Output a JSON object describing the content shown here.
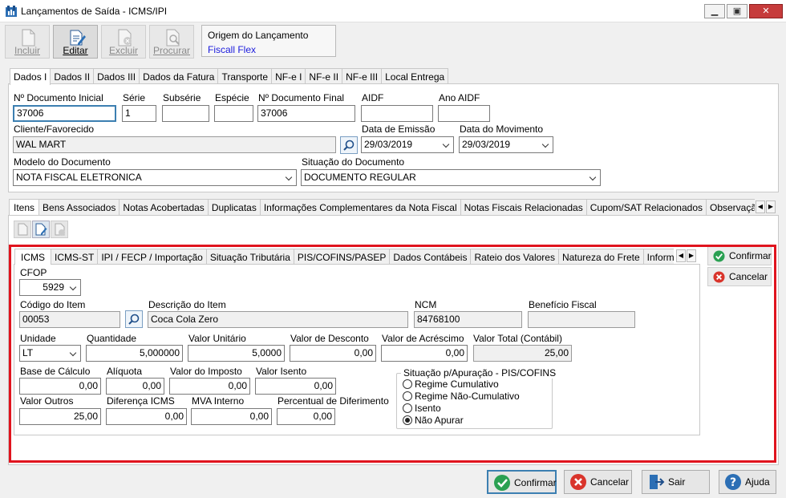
{
  "window": {
    "title": "Lançamentos de Saída - ICMS/IPI"
  },
  "toolbar": {
    "incluir": "Incluir",
    "editar": "Editar",
    "excluir": "Excluir",
    "procurar": "Procurar"
  },
  "origin": {
    "label": "Origem do Lançamento",
    "value": "Fiscall Flex"
  },
  "main_tabs": [
    "Dados I",
    "Dados II",
    "Dados III",
    "Dados da Fatura",
    "Transporte",
    "NF-e I",
    "NF-e II",
    "NF-e III",
    "Local Entrega"
  ],
  "header": {
    "doc_inicial": {
      "label": "Nº Documento Inicial",
      "value": "37006"
    },
    "serie": {
      "label": "Série",
      "value": "1"
    },
    "subserie": {
      "label": "Subsérie",
      "value": ""
    },
    "especie": {
      "label": "Espécie",
      "value": ""
    },
    "doc_final": {
      "label": "Nº Documento Final",
      "value": "37006"
    },
    "aidf": {
      "label": "AIDF",
      "value": ""
    },
    "ano_aidf": {
      "label": "Ano AIDF",
      "value": ""
    },
    "cliente": {
      "label": "Cliente/Favorecido",
      "value": "WAL MART"
    },
    "data_emissao": {
      "label": "Data de Emissão",
      "value": "29/03/2019"
    },
    "data_movimento": {
      "label": "Data do Movimento",
      "value": "29/03/2019"
    },
    "modelo": {
      "label": "Modelo do Documento",
      "value": "NOTA FISCAL ELETRONICA"
    },
    "situacao": {
      "label": "Situação do Documento",
      "value": "DOCUMENTO REGULAR"
    }
  },
  "item_tabs": [
    "Itens",
    "Bens Associados",
    "Notas Acobertadas",
    "Duplicatas",
    "Informações Complementares da Nota Fiscal",
    "Notas Fiscais Relacionadas",
    "Cupom/SAT Relacionados",
    "Observação d"
  ],
  "tax_tabs": [
    "ICMS",
    "ICMS-ST",
    "IPI / FECP / Importação",
    "Situação Tributária",
    "PIS/COFINS/PASEP",
    "Dados Contábeis",
    "Rateio dos Valores",
    "Natureza do Frete",
    "Informações"
  ],
  "icms": {
    "cfop": {
      "label": "CFOP",
      "value": "5929"
    },
    "codigo_item": {
      "label": "Código do Item",
      "value": "00053"
    },
    "descricao_item": {
      "label": "Descrição do Item",
      "value": "Coca Cola Zero"
    },
    "ncm": {
      "label": "NCM",
      "value": "84768100"
    },
    "beneficio": {
      "label": "Benefício Fiscal",
      "value": ""
    },
    "unidade": {
      "label": "Unidade",
      "value": "LT"
    },
    "quantidade": {
      "label": "Quantidade",
      "value": "5,000000"
    },
    "valor_unitario": {
      "label": "Valor Unitário",
      "value": "5,0000"
    },
    "valor_desconto": {
      "label": "Valor de Desconto",
      "value": "0,00"
    },
    "valor_acrescimo": {
      "label": "Valor de Acréscimo",
      "value": "0,00"
    },
    "valor_total": {
      "label": "Valor Total (Contábil)",
      "value": "25,00"
    },
    "base_calculo": {
      "label": "Base de Cálculo",
      "value": "0,00"
    },
    "aliquota": {
      "label": "Alíquota",
      "value": "0,00"
    },
    "valor_imposto": {
      "label": "Valor do Imposto",
      "value": "0,00"
    },
    "valor_isento": {
      "label": "Valor Isento",
      "value": "0,00"
    },
    "valor_outros": {
      "label": "Valor Outros",
      "value": "25,00"
    },
    "diferenca_icms": {
      "label": "Diferença ICMS",
      "value": "0,00"
    },
    "mva_interno": {
      "label": "MVA Interno",
      "value": "0,00"
    },
    "perc_diferimento": {
      "label": "Percentual de Diferimento",
      "value": "0,00"
    }
  },
  "situacao_pis": {
    "title": "Situação p/Apuração - PIS/COFINS",
    "options": [
      "Regime Cumulativo",
      "Regime Não-Cumulativo",
      "Isento",
      "Não Apurar"
    ],
    "selected": "Não Apurar"
  },
  "side_buttons": {
    "confirmar": "Confirmar",
    "cancelar": "Cancelar"
  },
  "bottom_buttons": {
    "confirmar": "Confirmar",
    "cancelar": "Cancelar",
    "sair": "Sair",
    "ajuda": "Ajuda"
  },
  "colors": {
    "highlight_border": "#e0141e",
    "focus_border": "#3c7fb1",
    "link_blue": "#1a1adc"
  }
}
